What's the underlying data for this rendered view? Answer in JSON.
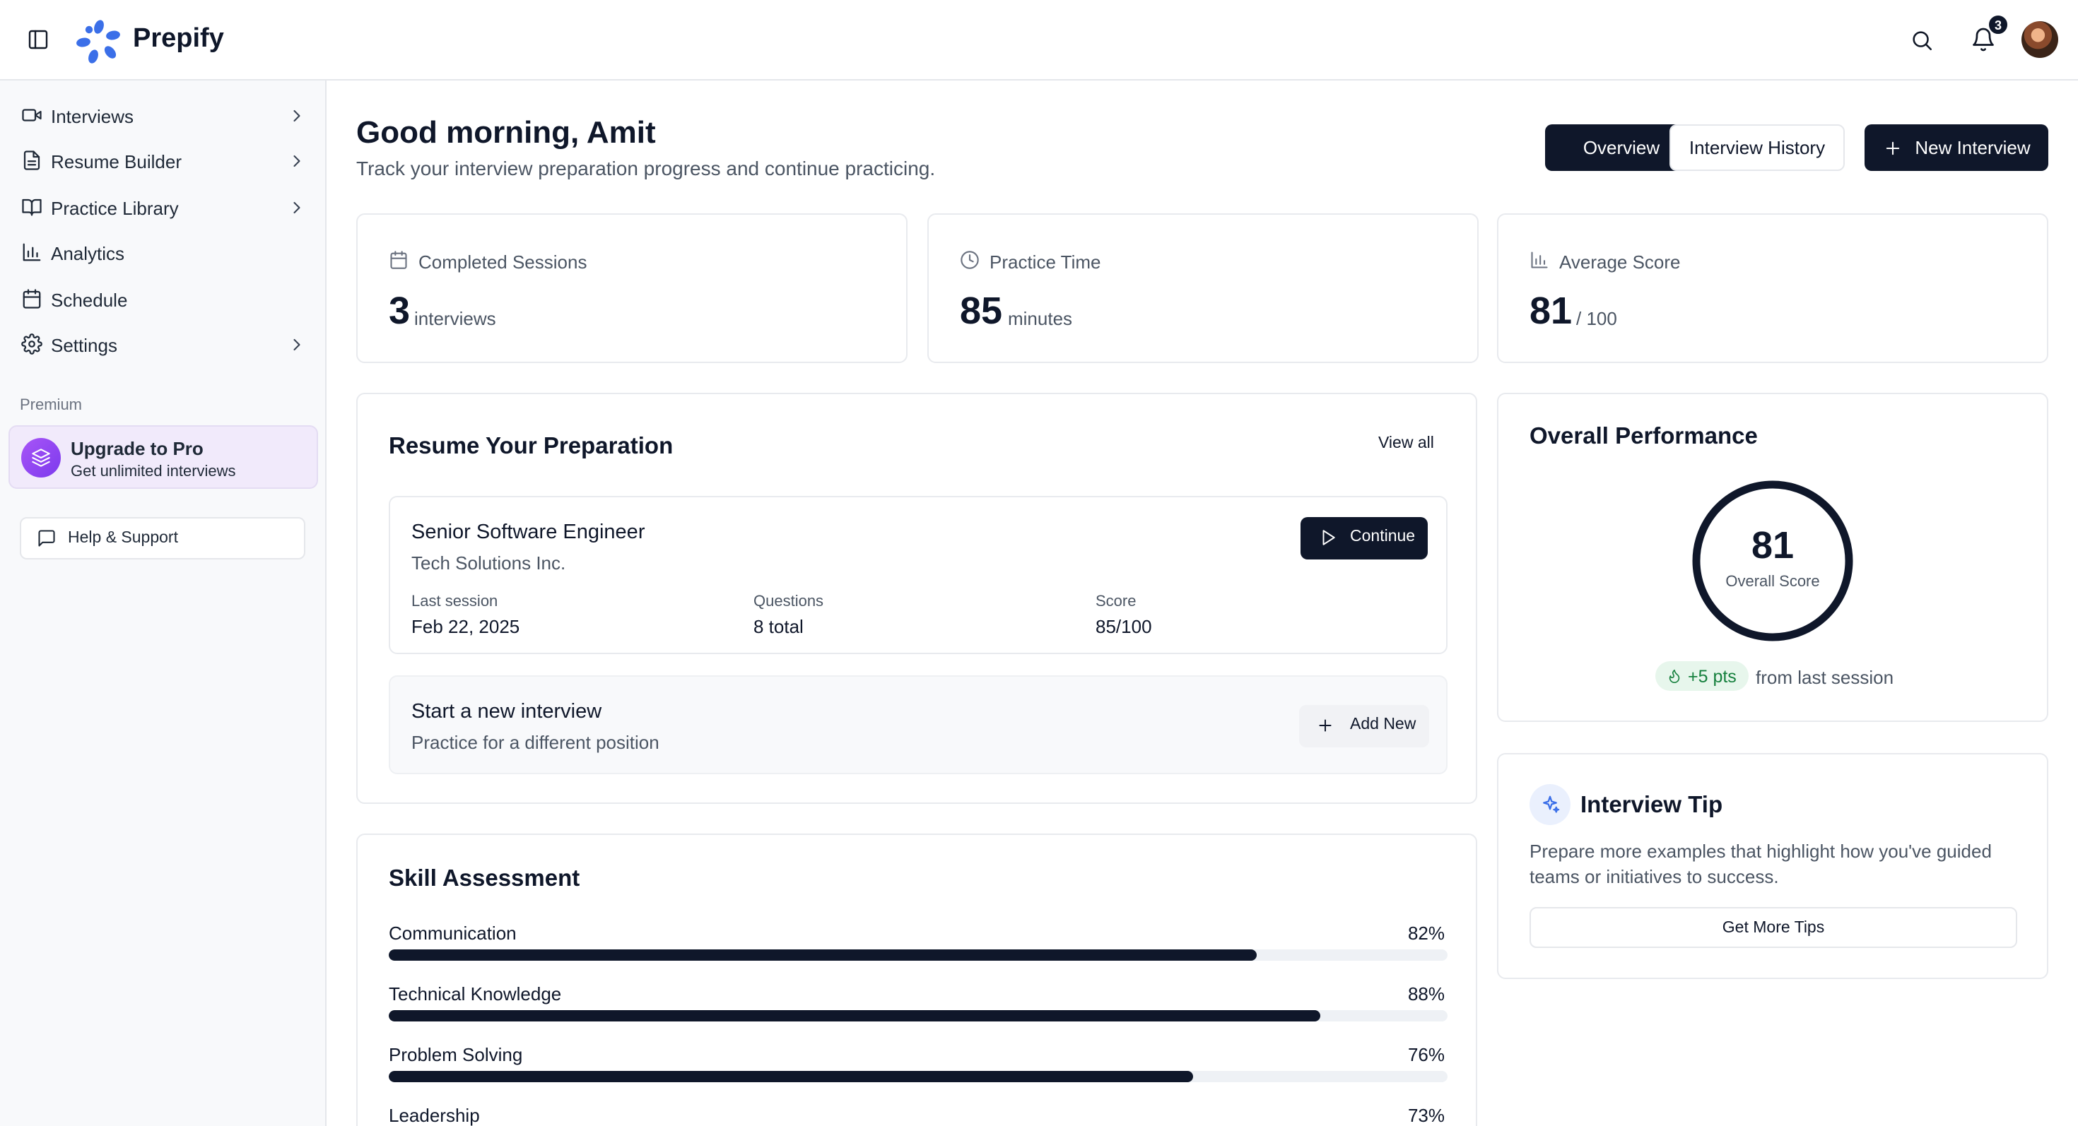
{
  "app": {
    "name": "Prepify"
  },
  "header": {
    "notification_count": "3"
  },
  "sidebar": {
    "items": [
      {
        "label": "Interviews",
        "icon": "video-icon",
        "has_submenu": true
      },
      {
        "label": "Resume Builder",
        "icon": "file-text-icon",
        "has_submenu": true
      },
      {
        "label": "Practice Library",
        "icon": "book-open-icon",
        "has_submenu": true
      },
      {
        "label": "Analytics",
        "icon": "bar-chart-icon",
        "has_submenu": false
      },
      {
        "label": "Schedule",
        "icon": "calendar-icon",
        "has_submenu": false
      },
      {
        "label": "Settings",
        "icon": "gear-icon",
        "has_submenu": true
      }
    ],
    "section_label": "Premium",
    "upgrade": {
      "title": "Upgrade to Pro",
      "subtitle": "Get unlimited interviews"
    },
    "help_label": "Help & Support"
  },
  "page": {
    "greeting": "Good morning, Amit",
    "subtitle": "Track your interview preparation progress and continue practicing.",
    "tabs": [
      {
        "label": "Overview",
        "active": true
      },
      {
        "label": "Interview History",
        "active": false
      }
    ],
    "new_interview_label": "New Interview"
  },
  "stats": [
    {
      "label": "Completed Sessions",
      "value": "3",
      "unit": "interviews",
      "icon": "calendar-icon"
    },
    {
      "label": "Practice Time",
      "value": "85",
      "unit": "minutes",
      "icon": "clock-icon"
    },
    {
      "label": "Average Score",
      "value": "81",
      "unit": "/ 100",
      "icon": "bar-chart-icon"
    }
  ],
  "resume": {
    "title": "Resume Your Preparation",
    "view_all": "View all",
    "session": {
      "role": "Senior Software Engineer",
      "company": "Tech Solutions Inc.",
      "continue_label": "Continue",
      "meta": [
        {
          "label": "Last session",
          "value": "Feb 22, 2025"
        },
        {
          "label": "Questions",
          "value": "8 total"
        },
        {
          "label": "Score",
          "value": "85/100"
        }
      ]
    },
    "new_interview": {
      "title": "Start a new interview",
      "subtitle": "Practice for a different position",
      "button": "Add New"
    }
  },
  "skills": {
    "title": "Skill Assessment",
    "items": [
      {
        "name": "Communication",
        "percent": 82,
        "percent_label": "82%"
      },
      {
        "name": "Technical Knowledge",
        "percent": 88,
        "percent_label": "88%"
      },
      {
        "name": "Problem Solving",
        "percent": 76,
        "percent_label": "76%"
      },
      {
        "name": "Leadership",
        "percent": 73,
        "percent_label": "73%"
      }
    ]
  },
  "performance": {
    "title": "Overall Performance",
    "score": "81",
    "score_label": "Overall Score",
    "delta": "+5 pts",
    "delta_note": "from last session"
  },
  "tip": {
    "title": "Interview Tip",
    "text": "Prepare more examples that highlight how you've guided teams or initiatives to success.",
    "button": "Get More Tips"
  },
  "colors": {
    "primary": "#0f172a",
    "accent_purple": "#7c3aed",
    "accent_blue": "#3b6fe8",
    "success": "#15803d"
  }
}
